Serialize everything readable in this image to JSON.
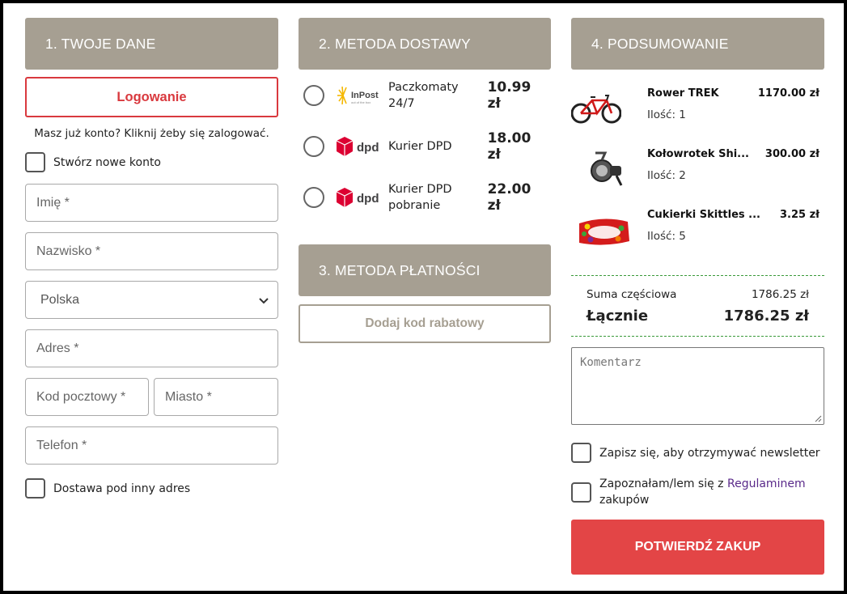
{
  "colors": {
    "header_bg": "#a69f92",
    "accent_red": "#e34546",
    "login_red": "#d9393e",
    "divider_green": "#3a9a3a",
    "link_purple": "#5a2a8a"
  },
  "personal": {
    "header": "1. TWOJE DANE",
    "login_button": "Logowanie",
    "login_hint": "Masz już konto? Kliknij żeby się zalogować.",
    "create_account": "Stwórz nowe konto",
    "first_name_placeholder": "Imię *",
    "last_name_placeholder": "Nazwisko *",
    "country_value": "Polska",
    "address_placeholder": "Adres *",
    "postal_code_placeholder": "Kod pocztowy *",
    "city_placeholder": "Miasto *",
    "phone_placeholder": "Telefon *",
    "other_address": "Dostawa pod inny adres"
  },
  "shipping": {
    "header": "2. METODA DOSTAWY",
    "options": [
      {
        "logo": "inpost-logo",
        "name": "Paczkomaty 24/7",
        "price": "10.99 zł"
      },
      {
        "logo": "dpd-logo",
        "name": "Kurier DPD",
        "price": "18.00 zł"
      },
      {
        "logo": "dpd-logo",
        "name": "Kurier DPD pobranie",
        "price": "22.00 zł"
      }
    ]
  },
  "payment": {
    "header": "3. METODA PŁATNOŚCI",
    "discount_button": "Dodaj kod rabatowy"
  },
  "summary": {
    "header": "4. PODSUMOWANIE",
    "products": [
      {
        "image": "bike-image",
        "name": "Rower TREK",
        "qty": "Ilość: 1",
        "price": "1170.00 zł"
      },
      {
        "image": "reel-image",
        "name": "Kołowrotek Shi...",
        "qty": "Ilość: 2",
        "price": "300.00 zł"
      },
      {
        "image": "skittles-image",
        "name": "Cukierki Skittles ...",
        "qty": "Ilość: 5",
        "price": "3.25 zł"
      }
    ],
    "subtotal_label": "Suma częściowa",
    "subtotal_value": "1786.25 zł",
    "total_label": "Łącznie",
    "total_value": "1786.25 zł",
    "comment_placeholder": "Komentarz",
    "newsletter": "Zapisz się, aby otrzymywać newsletter",
    "terms_prefix": "Zapoznałam/lem się z",
    "terms_link": "Regulaminem",
    "terms_suffix": "zakupów",
    "confirm_button": "POTWIERDŹ ZAKUP"
  }
}
